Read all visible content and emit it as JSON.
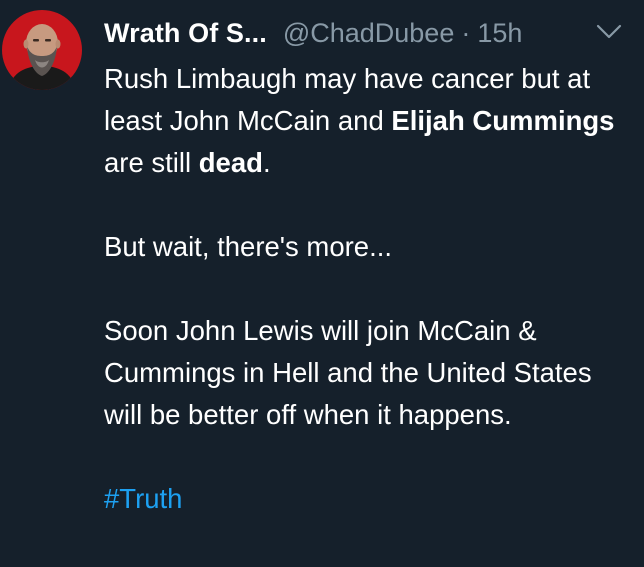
{
  "tweet": {
    "author_name": "Wrath Of S...",
    "author_handle": "@ChadDubee",
    "separator": "·",
    "time": "15h",
    "caret_icon": "chevron-down-icon",
    "paragraph1": {
      "part1": "Rush Limbaugh may have cancer but at least John McCain and ",
      "bold1": "Elijah Cummings",
      "part2": " are still ",
      "bold2": "dead",
      "part3": "."
    },
    "paragraph2": "But wait, there's more...",
    "paragraph3": "Soon John Lewis will join McCain & Cummings in Hell and the United States will be better off when it happens.",
    "hashtag": "#Truth"
  },
  "colors": {
    "background": "#15202b",
    "text": "#ffffff",
    "muted": "#8899a6",
    "link": "#1da1f2",
    "avatar_bg": "#c8161d"
  }
}
